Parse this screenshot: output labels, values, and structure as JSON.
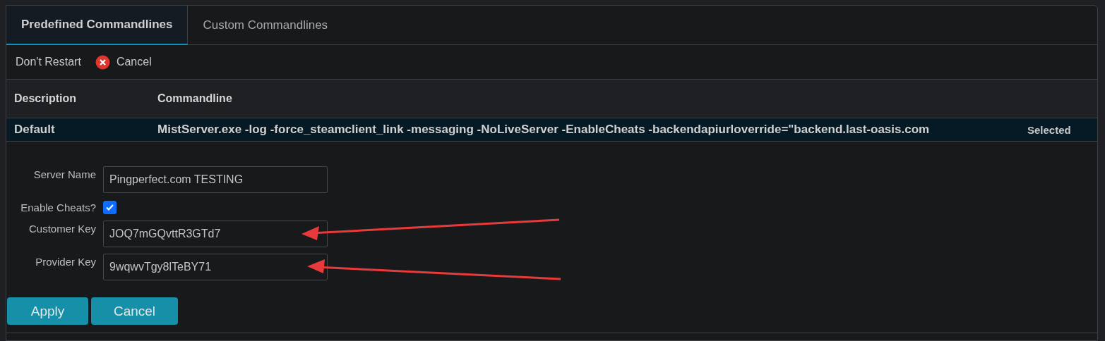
{
  "tabs": [
    {
      "label": "Predefined Commandlines",
      "selected": true
    },
    {
      "label": "Custom Commandlines",
      "selected": false
    }
  ],
  "toolbar": {
    "restart_label": "Don't Restart",
    "cancel_label": "Cancel"
  },
  "table": {
    "columns": [
      "Description",
      "Commandline"
    ],
    "rows": [
      {
        "description": "Default",
        "commandline": "MistServer.exe -log -force_steamclient_link -messaging -NoLiveServer -EnableCheats -backendapiurloverride=\"backend.last-oasis.com",
        "badge": "Selected",
        "selected": true
      }
    ]
  },
  "form": {
    "fields": [
      {
        "kind": "text",
        "label": "Server Name",
        "value": "Pingperfect.com TESTING"
      },
      {
        "kind": "checkbox",
        "label": "Enable Cheats?",
        "checked": true
      },
      {
        "kind": "text",
        "label": "Customer Key",
        "value": "JOQ7mGQvttR3GTd7"
      },
      {
        "kind": "text",
        "label": "Provider Key",
        "value": "9wqwvTgy8lTeBY71"
      }
    ],
    "buttons": [
      "Apply",
      "Cancel"
    ]
  }
}
